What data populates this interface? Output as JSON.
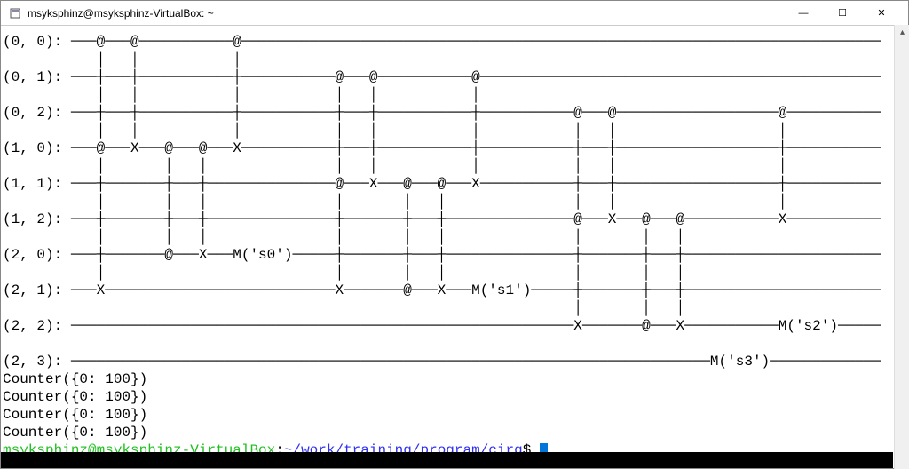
{
  "window": {
    "title": "msyksphinz@msyksphinz-VirtualBox: ~",
    "min": "—",
    "max": "☐",
    "close": "✕"
  },
  "circuit": {
    "lines": [
      "(0, 0): ───@───@───────────@───────────────────────────────────────────────────────────────────────────",
      "           │   │           │",
      "(0, 1): ───┼───┼───────────┼───────────@───@───────────@───────────────────────────────────────────────",
      "           │   │           │           │   │           │",
      "(0, 2): ───┼───┼───────────┼───────────┼───┼───────────┼───────────@───@───────────────────@───────────",
      "           │   │           │           │   │           │           │   │                   │",
      "(1, 0): ───@───X───@───@───X───────────┼───┼───────────┼───────────┼───┼───────────────────┼───────────",
      "           │       │   │               │   │           │           │   │                   │",
      "(1, 1): ───┼───────┼───┼───────────────@───X───@───@───X───────────┼───┼───────────────────┼───────────",
      "           │       │   │               │       │   │               │   │                   │",
      "(1, 2): ───┼───────┼───┼───────────────┼───────┼───┼───────────────@───X───@───@───────────X───────────",
      "           │       │   │               │       │   │               │       │   │",
      "(2, 0): ───┼───────@───X───M('s0')─────┼───────┼───┼───────────────┼───────┼───┼───────────────────────",
      "           │                           │       │   │               │       │   │",
      "(2, 1): ───X───────────────────────────X───────@───X───M('s1')─────┼───────┼───┼───────────────────────",
      "                                                                   │       │   │",
      "(2, 2): ───────────────────────────────────────────────────────────X───────@───X───────────M('s2')─────",
      "",
      "(2, 3): ───────────────────────────────────────────────────────────────────────────M('s3')─────────────"
    ],
    "counters": [
      "Counter({0: 100})",
      "Counter({0: 100})",
      "Counter({0: 100})",
      "Counter({0: 100})"
    ]
  },
  "prompt": {
    "user": "msyksphinz@msyksphinz-VirtualBox",
    "colon": ":",
    "path": "~/work/training/program/cirq",
    "dollar": "$ "
  }
}
